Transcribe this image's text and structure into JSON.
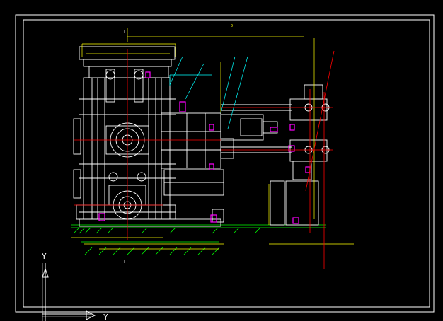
{
  "ucs": {
    "y_label": "Y",
    "x_label": "Y"
  },
  "drawing": {
    "top_mark": "0",
    "colors": {
      "background": "#000000",
      "frame": "#ffffff",
      "geometry": "#ffffff",
      "dimension": "#ffff00",
      "leader": "#00ffff",
      "centerline": "#ff0000",
      "highlight": "#ff00ff",
      "ground_hatch": "#00ff00"
    }
  }
}
